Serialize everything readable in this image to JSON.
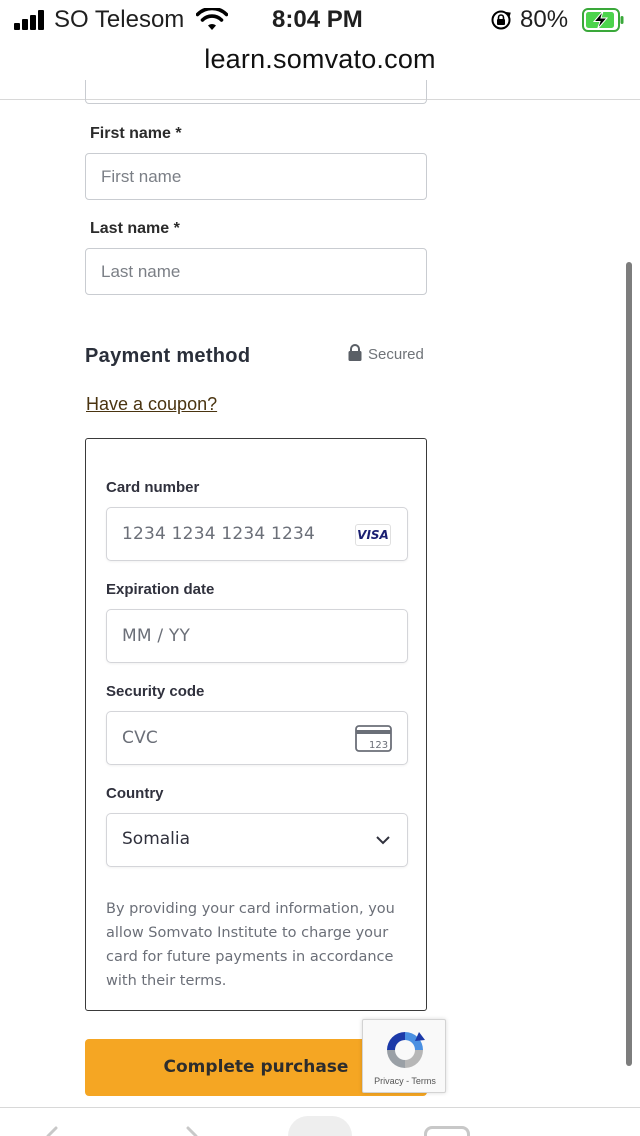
{
  "status_bar": {
    "carrier": "SO Telesom",
    "time": "8:04 PM",
    "battery_percent": "80%"
  },
  "browser": {
    "url": "learn.somvato.com"
  },
  "form": {
    "first_name_label": "First name *",
    "first_name_placeholder": "First name",
    "last_name_label": "Last name *",
    "last_name_placeholder": "Last name",
    "payment_title": "Payment method",
    "secured_text": "Secured",
    "coupon_link": "Have a coupon?"
  },
  "card": {
    "number_label": "Card number",
    "number_placeholder": "1234 1234 1234 1234",
    "brand_badge": "VISA",
    "expiry_label": "Expiration date",
    "expiry_placeholder": "MM / YY",
    "security_label": "Security code",
    "security_placeholder": "CVC",
    "cvc_icon_text": "123",
    "country_label": "Country",
    "country_value": "Somalia",
    "consent_text": "By providing your card information, you allow Somvato Institute to charge your card for future payments in accordance with their terms."
  },
  "actions": {
    "purchase_label": "Complete purchase"
  },
  "recaptcha": {
    "terms_text": "Privacy - Terms"
  },
  "colors": {
    "accent": "#f5a623",
    "link": "#4a3410",
    "visa_blue": "#1a1f71"
  }
}
